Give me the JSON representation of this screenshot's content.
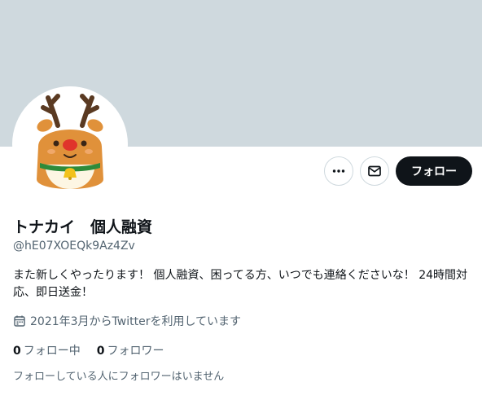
{
  "profile": {
    "display_name": "トナカイ　個人融資",
    "handle": "@hE07XOEQk9Az4Zv",
    "bio": "また新しくやったります！ 個人融資、困ってる方、いつでも連絡くださいな！ 24時間対応、即日送金！",
    "joined": "2021年3月からTwitterを利用しています",
    "avatar_icon": "reindeer-avatar"
  },
  "actions": {
    "more_icon": "more-dots-icon",
    "message_icon": "envelope-icon",
    "follow_label": "フォロー"
  },
  "stats": {
    "following_count": "0",
    "following_label": "フォロー中",
    "followers_count": "0",
    "followers_label": "フォロワー"
  },
  "footer_note": "フォローしている人にフォロワーはいません",
  "colors": {
    "banner": "#cfd9de",
    "primary_text": "#0f1419",
    "secondary_text": "#536471",
    "follow_button": "#0f1419"
  }
}
